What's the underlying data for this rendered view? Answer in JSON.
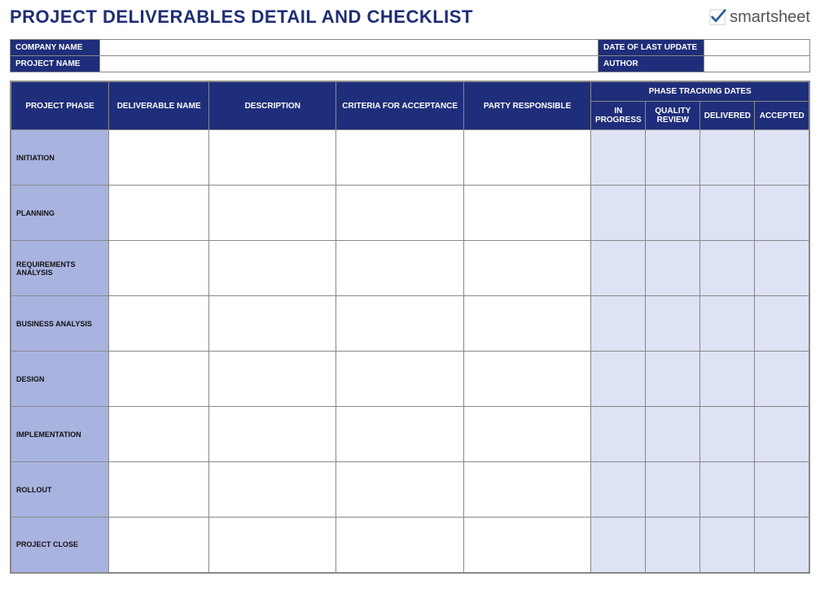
{
  "title": "PROJECT DELIVERABLES DETAIL AND CHECKLIST",
  "brand": {
    "name": "smartsheet"
  },
  "meta": {
    "labels": {
      "company": "COMPANY NAME",
      "project": "PROJECT NAME",
      "lastUpdate": "DATE OF LAST UPDATE",
      "author": "AUTHOR"
    },
    "values": {
      "company": "",
      "project": "",
      "lastUpdate": "",
      "author": ""
    }
  },
  "columns": {
    "phase": "PROJECT PHASE",
    "deliverable": "DELIVERABLE NAME",
    "description": "DESCRIPTION",
    "criteria": "CRITERIA FOR ACCEPTANCE",
    "party": "PARTY RESPONSIBLE",
    "trackingGroup": "PHASE TRACKING DATES",
    "tracking": {
      "inProgress": "IN PROGRESS",
      "qualityReview": "QUALITY REVIEW",
      "delivered": "DELIVERED",
      "accepted": "ACCEPTED"
    }
  },
  "phases": [
    {
      "name": "INITIATION"
    },
    {
      "name": "PLANNING"
    },
    {
      "name": "REQUIREMENTS ANALYSIS"
    },
    {
      "name": "BUSINESS ANALYSIS"
    },
    {
      "name": "DESIGN"
    },
    {
      "name": "IMPLEMENTATION"
    },
    {
      "name": "ROLLOUT"
    },
    {
      "name": "PROJECT CLOSE"
    }
  ]
}
